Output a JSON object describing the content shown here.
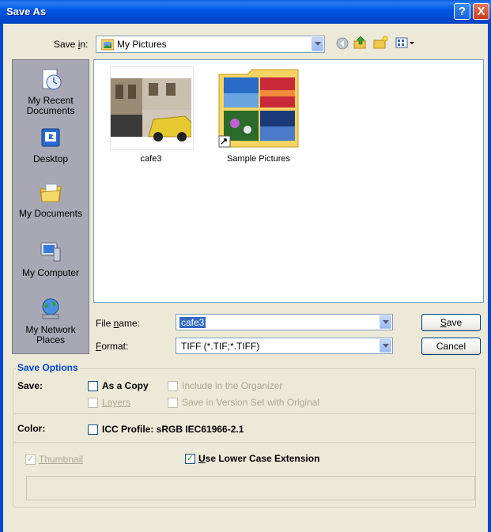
{
  "window": {
    "title": "Save As",
    "help_glyph": "?",
    "close_glyph": "X"
  },
  "toolbar": {
    "save_in_label_pre": "Save ",
    "save_in_label_ul": "i",
    "save_in_label_post": "n:",
    "location": "My Pictures"
  },
  "places": [
    {
      "label": "My Recent Documents",
      "icon": "recent-documents-icon"
    },
    {
      "label": "Desktop",
      "icon": "desktop-icon"
    },
    {
      "label": "My Documents",
      "icon": "my-documents-icon"
    },
    {
      "label": "My Computer",
      "icon": "my-computer-icon"
    },
    {
      "label": "My Network Places",
      "icon": "network-places-icon"
    }
  ],
  "files": [
    {
      "name": "cafe3",
      "type": "image"
    },
    {
      "name": "Sample Pictures",
      "type": "folder-shortcut"
    }
  ],
  "form": {
    "filename_label_pre": "File ",
    "filename_label_ul": "n",
    "filename_label_post": "ame:",
    "filename_value": "cafe3",
    "format_label_ul": "F",
    "format_label_post": "ormat:",
    "format_value": "TIFF (*.TIF;*.TIFF)",
    "save_button_ul": "S",
    "save_button_post": "ave",
    "cancel_button": "Cancel"
  },
  "save_options": {
    "heading": "Save Options",
    "save_label": "Save:",
    "as_a_copy": "As a Copy",
    "include_organizer": "Include in the Organizer",
    "layers": "Layers",
    "version_set": "Save in Version Set with Original",
    "color_label": "Color:",
    "icc_profile_pre": "ICC Profile: ",
    "icc_profile_value": "sRGB IEC61966-2.1",
    "thumbnail": "Thumbnail",
    "lower_case_ul": "U",
    "lower_case_post": "se Lower Case Extension"
  }
}
